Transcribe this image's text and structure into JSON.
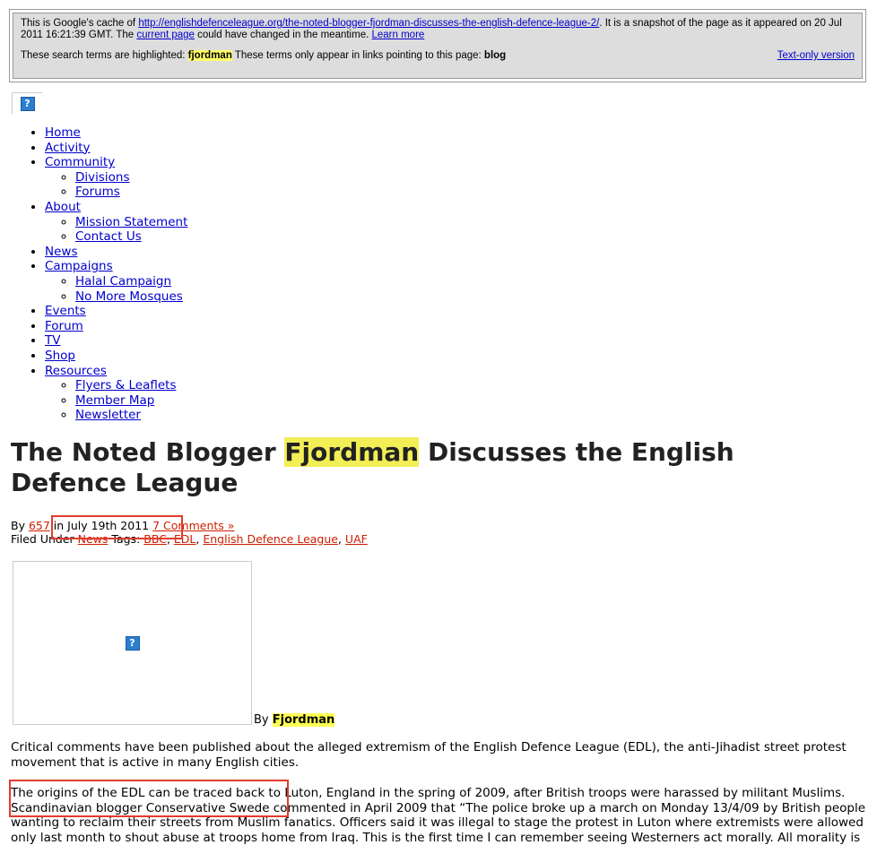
{
  "cache_banner": {
    "intro": "This is Google's cache of ",
    "url": "http://englishdefenceleague.org/the-noted-blogger-fjordman-discusses-the-english-defence-league-2/",
    "mid": ". It is a snapshot of the page as it appeared on 20 Jul 2011 16:21:39 GMT. The ",
    "current_page": "current page",
    "after_current": " could have changed in the meantime. ",
    "learn_more": "Learn more",
    "highlight_intro": "These search terms are highlighted: ",
    "highlight_term": "fjordman",
    "links_text": " These terms only appear in links pointing to this page: ",
    "links_term": "blog",
    "text_only": "Text-only version"
  },
  "image_placeholder": "?",
  "nav": {
    "home": "Home",
    "activity": "Activity",
    "community": "Community",
    "divisions": "Divisions",
    "forums": "Forums",
    "about": "About",
    "mission": "Mission Statement",
    "contact": "Contact Us",
    "news": "News",
    "campaigns": "Campaigns",
    "halal": "Halal Campaign",
    "mosques": "No More Mosques",
    "events": "Events",
    "forum": "Forum",
    "tv": "TV",
    "shop": "Shop",
    "resources": "Resources",
    "flyers": "Flyers & Leaflets",
    "member_map": "Member Map",
    "newsletter": "Newsletter"
  },
  "article": {
    "title_pre": "The Noted Blogger ",
    "title_hl": "Fjordman",
    "title_post": " Discusses the English Defence League",
    "by": "By ",
    "author": "657",
    "date_text": " in July 19th 2011 ",
    "comments": "7 Comments »",
    "filed_under": "Filed Under ",
    "category": "News",
    "tags_label": " Tags: ",
    "tag1": "BBC",
    "tag2": "EDL",
    "tag3": "English Defence League",
    "tag4": "UAF",
    "byline_by": "By ",
    "byline_name": "Fjordman",
    "para1": "Critical comments have been published about the alleged extremism of the English Defence League (EDL), the anti-Jihadist street protest movement that is active in many English cities.",
    "para2": "The origins of the EDL can be traced back to Luton, England in the spring of 2009, after British troops were harassed by militant Muslims. Scandinavian blogger Conservative Swede commented in April 2009 that “The police broke up a march on Monday 13/4/09 by British people wanting to reclaim their streets from Muslim fanatics. Officers said it was illegal to stage the protest in Luton where extremists were allowed only last month to shout abuse at troops home from Iraq. This is the first time I can remember seeing Westerners act morally. All morality is"
  },
  "colors": {
    "highlight": "#ffff66",
    "link": "#0000cc",
    "article_link": "#cc1f00",
    "annotation_box": "#e33b2e"
  }
}
